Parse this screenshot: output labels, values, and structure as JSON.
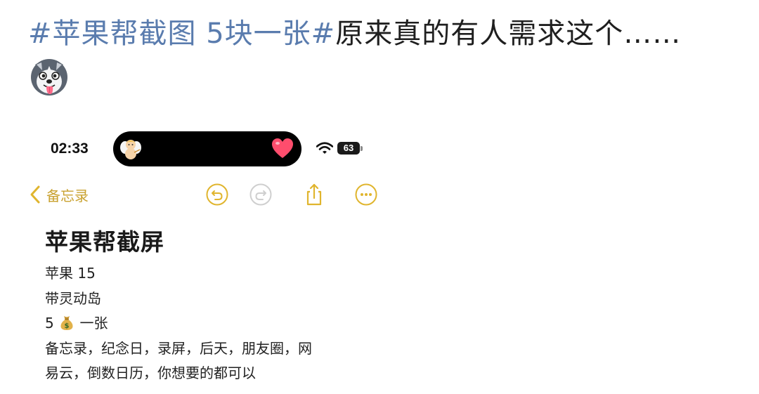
{
  "post": {
    "hashtag": "#苹果帮截图 5块一张#",
    "body": "原来真的有人需求这个……",
    "emoji": "husky-tongue-emoji"
  },
  "screenshot": {
    "status_bar": {
      "time": "02:33",
      "battery": "63"
    },
    "toolbar": {
      "back_label": "备忘录",
      "icons": [
        "undo-icon",
        "redo-icon",
        "share-icon",
        "more-icon"
      ]
    },
    "note": {
      "title": "苹果帮截屏",
      "lines": [
        "苹果 15",
        "带灵动岛",
        "5",
        "一张",
        "备忘录，纪念日，录屏，后天，朋友圈，网",
        "易云，倒数日历，你想要的都可以"
      ]
    },
    "colors": {
      "accent": "#e0b52e",
      "accent_text": "#c9a230",
      "hashtag": "#5a7cae",
      "heart": "#ff4d6d"
    }
  }
}
